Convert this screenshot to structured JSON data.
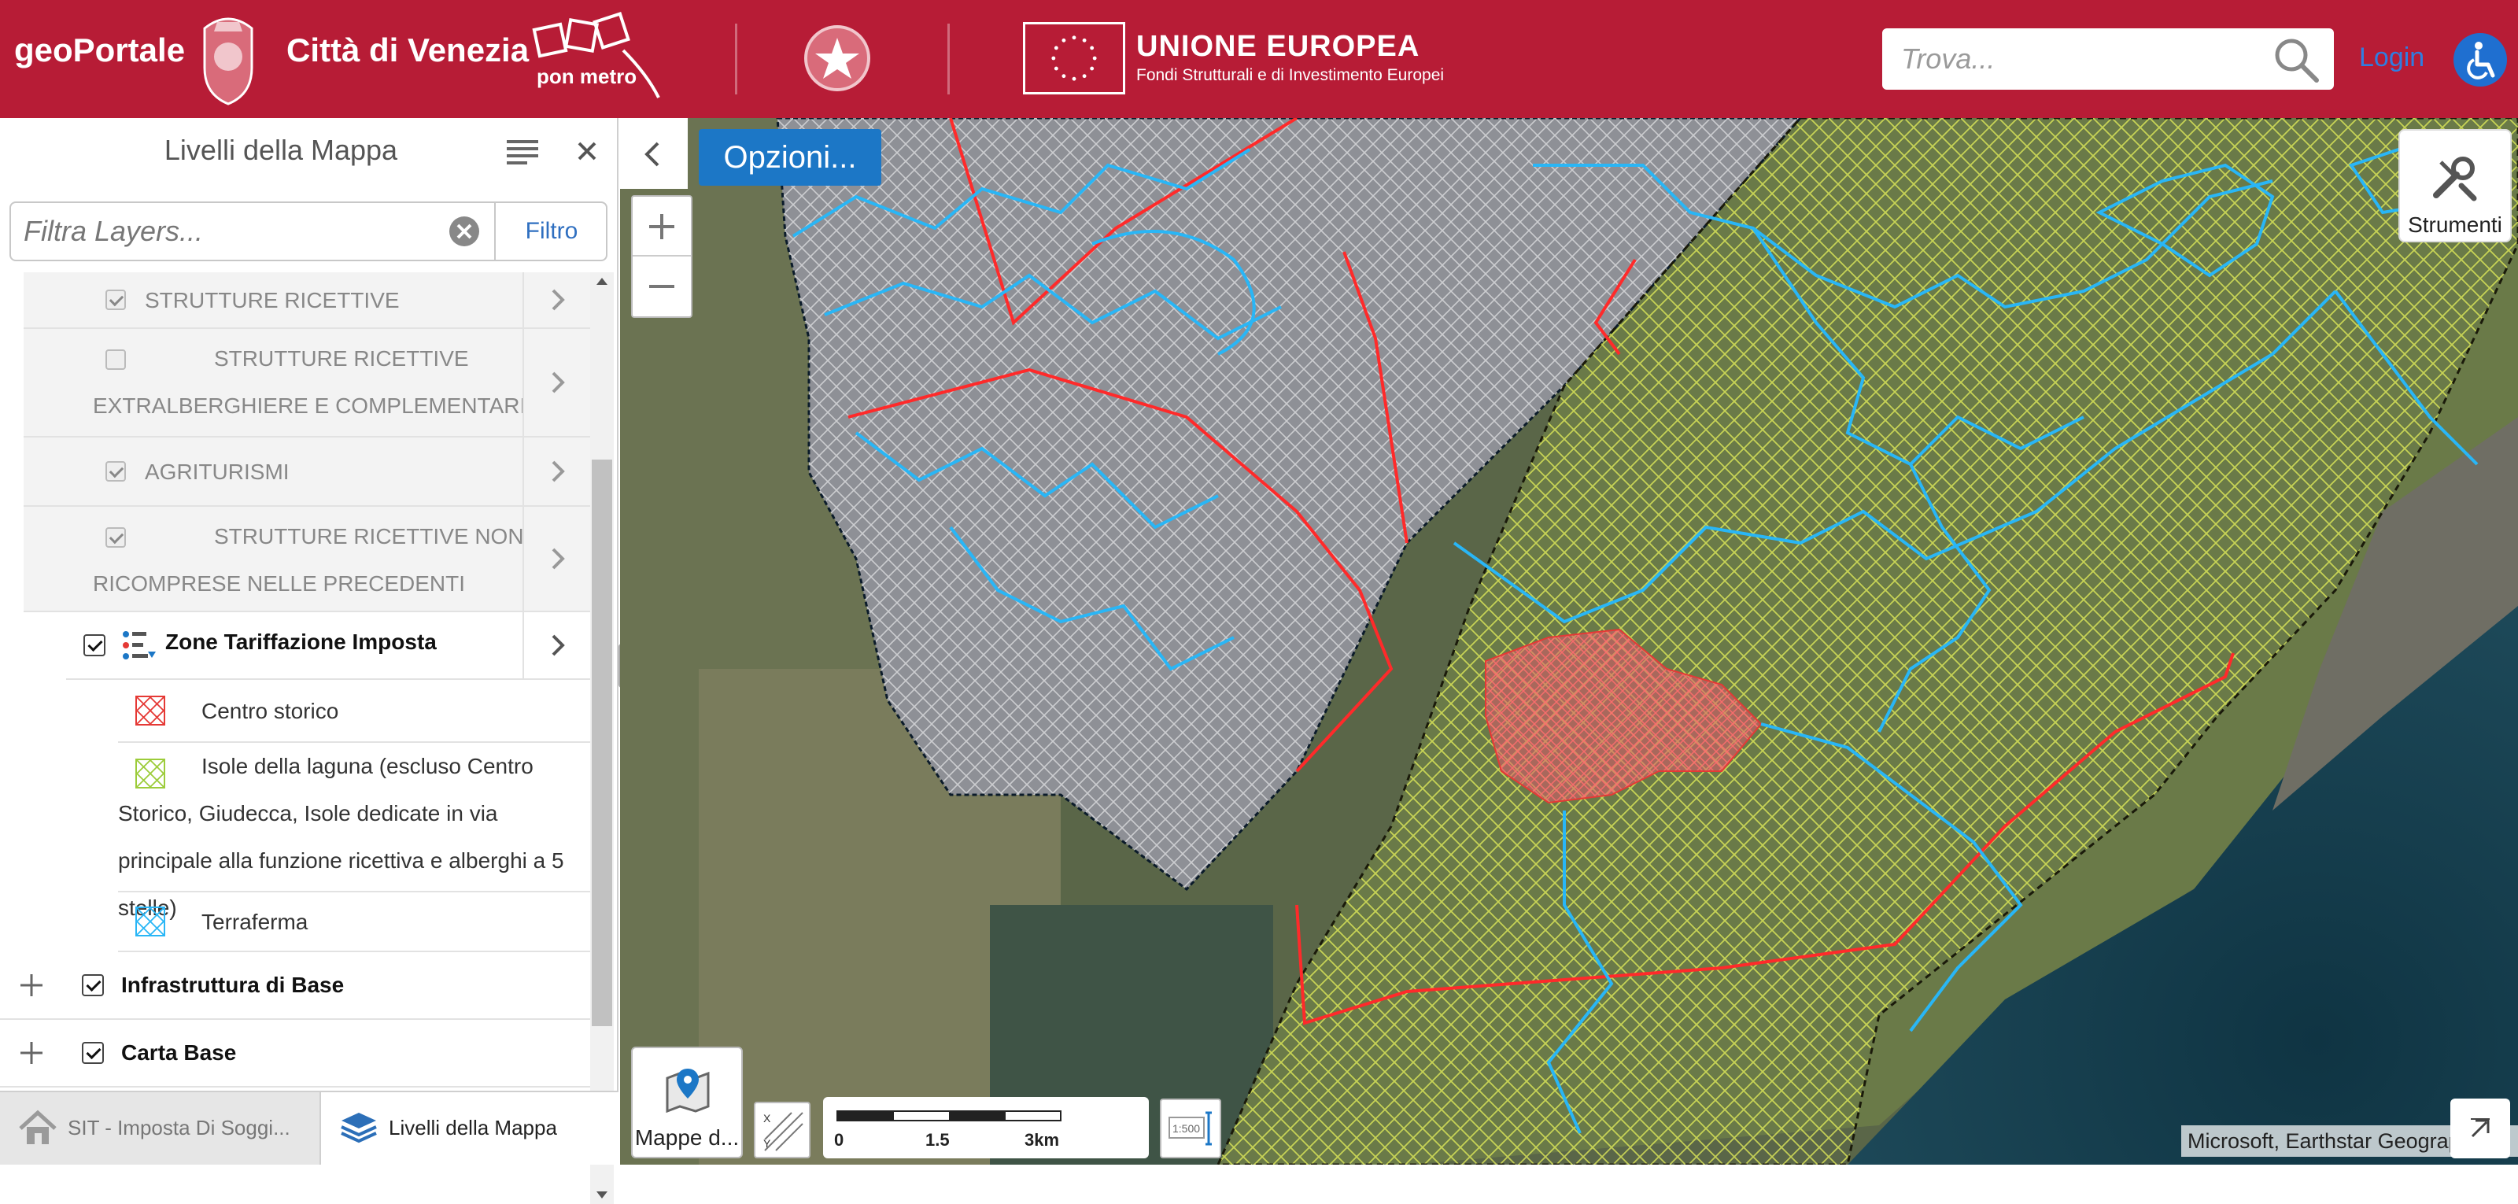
{
  "header": {
    "brand_left": "geoPortale",
    "brand_city": "Città di Venezia",
    "ponmetro_text": "pon metro",
    "eu_title": "UNIONE EUROPEA",
    "eu_subtitle": "Fondi Strutturali e di Investimento Europei",
    "search_placeholder": "Trova...",
    "login_label": "Login",
    "brand_color": "#b71c36"
  },
  "panel": {
    "title": "Livelli della Mappa",
    "filter_placeholder": "Filtra Layers...",
    "filter_button": "Filtro",
    "sublayers": [
      {
        "label": "STRUTTURE RICETTIVE ALL'APERTO",
        "checked": true
      },
      {
        "label": "STRUTTURE RICETTIVE EXTRALBERGHIERE E COMPLEMENTARI",
        "checked": false
      },
      {
        "label": "AGRITURISMI",
        "checked": true
      },
      {
        "label": "STRUTTURE RICETTIVE NON RICOMPRESE NELLE PRECEDENTI",
        "checked": true
      }
    ],
    "zone_layer": {
      "label": "Zone Tariffazione Imposta",
      "checked": true
    },
    "legend": [
      {
        "label": "Centro storico",
        "color": "#e53935"
      },
      {
        "label": "Isole della laguna (escluso Centro Storico, Giudecca, Isole dedicate in via principale alla funzione ricettiva e alberghi a 5 stelle)",
        "color": "#9ccc3a"
      },
      {
        "label": "Terraferma",
        "color": "#29b6f6"
      }
    ],
    "groups": [
      {
        "label": "Infrastruttura di Base",
        "checked": true
      },
      {
        "label": "Carta Base",
        "checked": true
      }
    ]
  },
  "bottom_tabs": [
    {
      "label": "SIT - Imposta Di Soggi...",
      "active": false
    },
    {
      "label": "Livelli della Mappa",
      "active": true
    }
  ],
  "map": {
    "options_label": "Opzioni...",
    "tools_label": "Strumenti",
    "basemaps_label": "Mappe d...",
    "scale_labels": [
      "0",
      "1.5",
      "3km"
    ],
    "scale_button_text": "1:500",
    "attribution": "Microsoft, Earthstar Geographics",
    "zone_colors": {
      "centro": "#e53935",
      "isole": "#c6e05a",
      "terraferma": "#29b6f6"
    }
  }
}
